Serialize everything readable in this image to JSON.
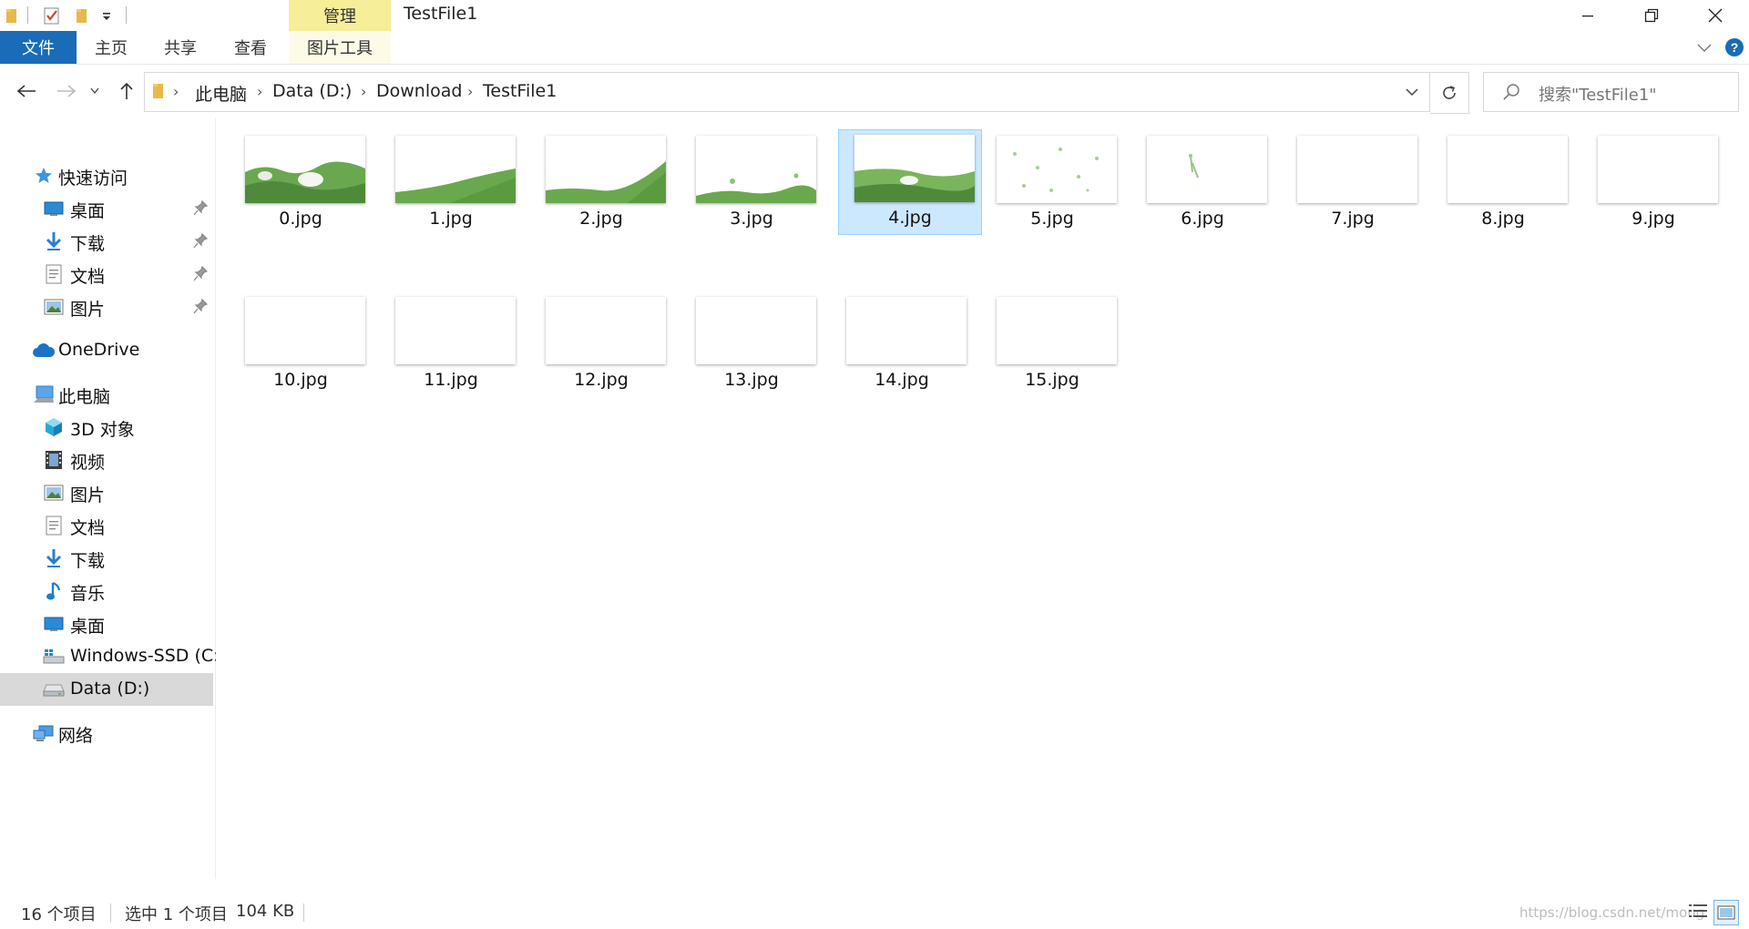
{
  "window": {
    "title": "TestFile1",
    "contextual_tab": "管理",
    "contextual_group": "图片工具"
  },
  "ribbon": {
    "file_label": "文件",
    "tabs": [
      "主页",
      "共享",
      "查看"
    ]
  },
  "address": {
    "crumbs": [
      "此电脑",
      "Data (D:)",
      "Download",
      "TestFile1"
    ]
  },
  "search": {
    "placeholder": "搜索\"TestFile1\""
  },
  "nav": {
    "quick_access": "快速访问",
    "pinned": [
      "桌面",
      "下载",
      "文档",
      "图片"
    ],
    "onedrive": "OneDrive",
    "this_pc": "此电脑",
    "pc_items": [
      "3D 对象",
      "视频",
      "图片",
      "文档",
      "下载",
      "音乐",
      "桌面",
      "Windows-SSD (C:)",
      "Data (D:)"
    ],
    "network": "网络",
    "selected_item": "Data (D:)"
  },
  "files": [
    "0.jpg",
    "1.jpg",
    "2.jpg",
    "3.jpg",
    "4.jpg",
    "5.jpg",
    "6.jpg",
    "7.jpg",
    "8.jpg",
    "9.jpg",
    "10.jpg",
    "11.jpg",
    "12.jpg",
    "13.jpg",
    "14.jpg",
    "15.jpg"
  ],
  "selected_file": "4.jpg",
  "status": {
    "count": "16 个项目",
    "selection": "选中 1 个项目",
    "size": "104 KB",
    "watermark": "https://blog.csdn.net/moug"
  },
  "colors": {
    "accent": "#1a6bb8",
    "manage_tab": "#f7ee9a",
    "selection": "#cce8ff",
    "grass_green": "#6aa84f"
  }
}
